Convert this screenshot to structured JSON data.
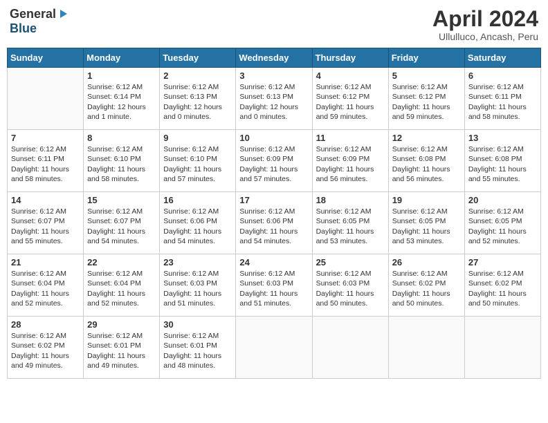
{
  "header": {
    "logo_general": "General",
    "logo_blue": "Blue",
    "month_year": "April 2024",
    "location": "Ullulluco, Ancash, Peru"
  },
  "weekdays": [
    "Sunday",
    "Monday",
    "Tuesday",
    "Wednesday",
    "Thursday",
    "Friday",
    "Saturday"
  ],
  "weeks": [
    [
      {
        "day": "",
        "info": ""
      },
      {
        "day": "1",
        "info": "Sunrise: 6:12 AM\nSunset: 6:14 PM\nDaylight: 12 hours\nand 1 minute."
      },
      {
        "day": "2",
        "info": "Sunrise: 6:12 AM\nSunset: 6:13 PM\nDaylight: 12 hours\nand 0 minutes."
      },
      {
        "day": "3",
        "info": "Sunrise: 6:12 AM\nSunset: 6:13 PM\nDaylight: 12 hours\nand 0 minutes."
      },
      {
        "day": "4",
        "info": "Sunrise: 6:12 AM\nSunset: 6:12 PM\nDaylight: 11 hours\nand 59 minutes."
      },
      {
        "day": "5",
        "info": "Sunrise: 6:12 AM\nSunset: 6:12 PM\nDaylight: 11 hours\nand 59 minutes."
      },
      {
        "day": "6",
        "info": "Sunrise: 6:12 AM\nSunset: 6:11 PM\nDaylight: 11 hours\nand 58 minutes."
      }
    ],
    [
      {
        "day": "7",
        "info": "Sunrise: 6:12 AM\nSunset: 6:11 PM\nDaylight: 11 hours\nand 58 minutes."
      },
      {
        "day": "8",
        "info": "Sunrise: 6:12 AM\nSunset: 6:10 PM\nDaylight: 11 hours\nand 58 minutes."
      },
      {
        "day": "9",
        "info": "Sunrise: 6:12 AM\nSunset: 6:10 PM\nDaylight: 11 hours\nand 57 minutes."
      },
      {
        "day": "10",
        "info": "Sunrise: 6:12 AM\nSunset: 6:09 PM\nDaylight: 11 hours\nand 57 minutes."
      },
      {
        "day": "11",
        "info": "Sunrise: 6:12 AM\nSunset: 6:09 PM\nDaylight: 11 hours\nand 56 minutes."
      },
      {
        "day": "12",
        "info": "Sunrise: 6:12 AM\nSunset: 6:08 PM\nDaylight: 11 hours\nand 56 minutes."
      },
      {
        "day": "13",
        "info": "Sunrise: 6:12 AM\nSunset: 6:08 PM\nDaylight: 11 hours\nand 55 minutes."
      }
    ],
    [
      {
        "day": "14",
        "info": "Sunrise: 6:12 AM\nSunset: 6:07 PM\nDaylight: 11 hours\nand 55 minutes."
      },
      {
        "day": "15",
        "info": "Sunrise: 6:12 AM\nSunset: 6:07 PM\nDaylight: 11 hours\nand 54 minutes."
      },
      {
        "day": "16",
        "info": "Sunrise: 6:12 AM\nSunset: 6:06 PM\nDaylight: 11 hours\nand 54 minutes."
      },
      {
        "day": "17",
        "info": "Sunrise: 6:12 AM\nSunset: 6:06 PM\nDaylight: 11 hours\nand 54 minutes."
      },
      {
        "day": "18",
        "info": "Sunrise: 6:12 AM\nSunset: 6:05 PM\nDaylight: 11 hours\nand 53 minutes."
      },
      {
        "day": "19",
        "info": "Sunrise: 6:12 AM\nSunset: 6:05 PM\nDaylight: 11 hours\nand 53 minutes."
      },
      {
        "day": "20",
        "info": "Sunrise: 6:12 AM\nSunset: 6:05 PM\nDaylight: 11 hours\nand 52 minutes."
      }
    ],
    [
      {
        "day": "21",
        "info": "Sunrise: 6:12 AM\nSunset: 6:04 PM\nDaylight: 11 hours\nand 52 minutes."
      },
      {
        "day": "22",
        "info": "Sunrise: 6:12 AM\nSunset: 6:04 PM\nDaylight: 11 hours\nand 52 minutes."
      },
      {
        "day": "23",
        "info": "Sunrise: 6:12 AM\nSunset: 6:03 PM\nDaylight: 11 hours\nand 51 minutes."
      },
      {
        "day": "24",
        "info": "Sunrise: 6:12 AM\nSunset: 6:03 PM\nDaylight: 11 hours\nand 51 minutes."
      },
      {
        "day": "25",
        "info": "Sunrise: 6:12 AM\nSunset: 6:03 PM\nDaylight: 11 hours\nand 50 minutes."
      },
      {
        "day": "26",
        "info": "Sunrise: 6:12 AM\nSunset: 6:02 PM\nDaylight: 11 hours\nand 50 minutes."
      },
      {
        "day": "27",
        "info": "Sunrise: 6:12 AM\nSunset: 6:02 PM\nDaylight: 11 hours\nand 50 minutes."
      }
    ],
    [
      {
        "day": "28",
        "info": "Sunrise: 6:12 AM\nSunset: 6:02 PM\nDaylight: 11 hours\nand 49 minutes."
      },
      {
        "day": "29",
        "info": "Sunrise: 6:12 AM\nSunset: 6:01 PM\nDaylight: 11 hours\nand 49 minutes."
      },
      {
        "day": "30",
        "info": "Sunrise: 6:12 AM\nSunset: 6:01 PM\nDaylight: 11 hours\nand 48 minutes."
      },
      {
        "day": "",
        "info": ""
      },
      {
        "day": "",
        "info": ""
      },
      {
        "day": "",
        "info": ""
      },
      {
        "day": "",
        "info": ""
      }
    ]
  ]
}
